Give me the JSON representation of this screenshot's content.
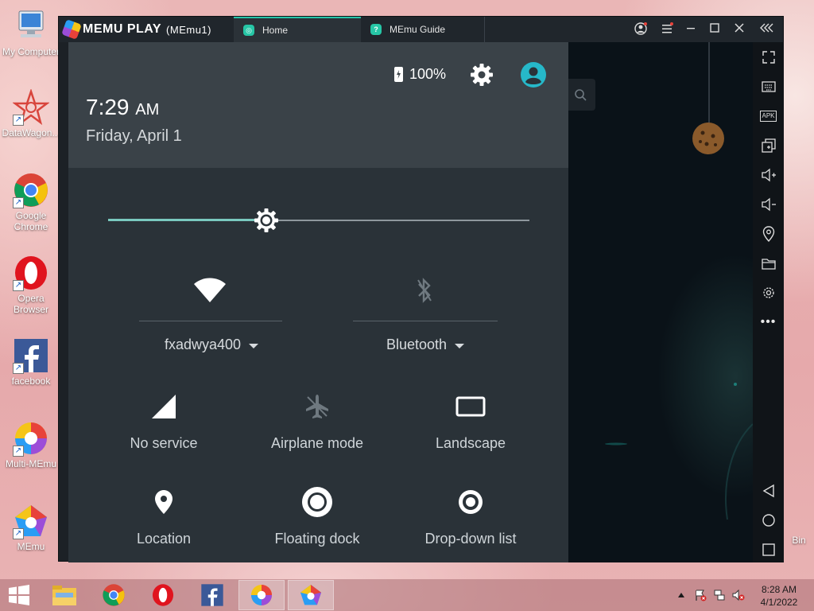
{
  "desktop": {
    "icons": [
      {
        "label": "My Computer",
        "icon": "computer-icon"
      },
      {
        "label": "DataWagon...",
        "icon": "datawagon-icon"
      },
      {
        "label": "Google Chrome",
        "icon": "chrome-icon"
      },
      {
        "label": "Opera Browser",
        "icon": "opera-icon"
      },
      {
        "label": "facebook",
        "icon": "facebook-icon"
      },
      {
        "label": "Multi-MEmu",
        "icon": "multi-memu-icon"
      },
      {
        "label": "MEmu",
        "icon": "memu-icon"
      }
    ],
    "recycle_bin_label": "Bin"
  },
  "window": {
    "brand": "MEMU PLAY",
    "instance": "(MEmu1)",
    "tabs": [
      {
        "label": "Home",
        "active": true
      },
      {
        "label": "MEmu Guide",
        "active": false
      }
    ]
  },
  "quick_settings": {
    "battery": "100%",
    "time": "7:29",
    "ampm": "AM",
    "date": "Friday, April 1",
    "brightness_fraction": 0.376,
    "wifi_label": "fxadwya400",
    "bluetooth_label": "Bluetooth",
    "tiles": [
      {
        "label": "No service",
        "icon": "signal-icon",
        "enabled": true
      },
      {
        "label": "Airplane mode",
        "icon": "airplane-icon",
        "enabled": false
      },
      {
        "label": "Landscape",
        "icon": "landscape-icon",
        "enabled": true
      },
      {
        "label": "Location",
        "icon": "location-icon",
        "enabled": true
      },
      {
        "label": "Floating dock",
        "icon": "floating-dock-icon",
        "enabled": true
      },
      {
        "label": "Drop-down list",
        "icon": "dropdown-list-icon",
        "enabled": true
      }
    ]
  },
  "toolbar": {
    "items": [
      "fullscreen-icon",
      "keyboard-icon",
      "apk-icon",
      "multi-window-icon",
      "volume-up-icon",
      "volume-down-icon",
      "location-icon",
      "folder-icon",
      "settings-icon",
      "more-icon"
    ],
    "apk_text": "APK",
    "nav": [
      "back-icon",
      "home-icon",
      "recents-icon"
    ]
  },
  "taskbar": {
    "items": [
      "file-explorer-icon",
      "chrome-icon",
      "opera-icon",
      "facebook-icon",
      "multi-memu-icon",
      "memu-icon"
    ],
    "time": "8:28 AM",
    "date": "4/1/2022"
  },
  "colors": {
    "accent": "#7ac9bf",
    "tab_accent": "#25c4a9",
    "avatar": "#26b8c9"
  }
}
